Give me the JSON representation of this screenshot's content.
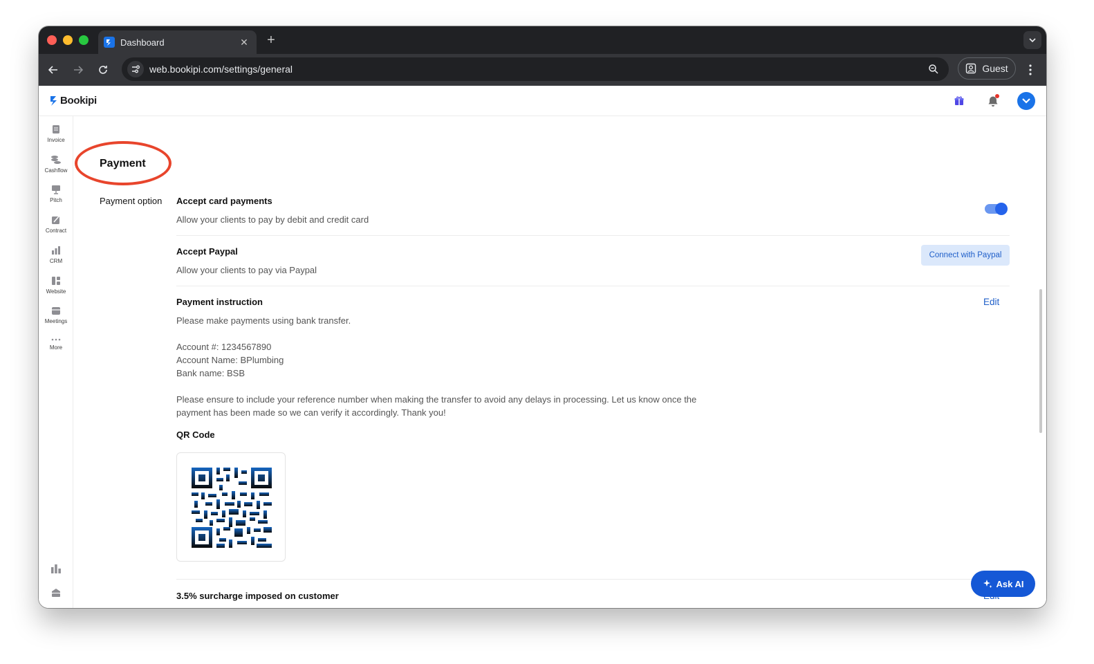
{
  "browser": {
    "tab_title": "Dashboard",
    "url": "web.bookipi.com/settings/general",
    "profile_label": "Guest"
  },
  "app": {
    "brand": "Bookipi",
    "accent_color": "#1a73e8"
  },
  "sidebar": {
    "items": [
      {
        "label": "Invoice",
        "icon": "invoice-icon"
      },
      {
        "label": "Cashflow",
        "icon": "cashflow-icon"
      },
      {
        "label": "Pitch",
        "icon": "pitch-icon"
      },
      {
        "label": "Contract",
        "icon": "contract-icon"
      },
      {
        "label": "CRM",
        "icon": "crm-icon"
      },
      {
        "label": "Website",
        "icon": "website-icon"
      },
      {
        "label": "Meetings",
        "icon": "meetings-icon"
      },
      {
        "label": "More",
        "icon": "more-icon"
      }
    ]
  },
  "payment": {
    "section_title": "Payment",
    "group_label": "Payment option",
    "card": {
      "title": "Accept card payments",
      "description": "Allow your clients to pay by debit and credit card",
      "enabled": true
    },
    "paypal": {
      "title": "Accept Paypal",
      "description": "Allow your clients to pay via Paypal",
      "button_label": "Connect with Paypal"
    },
    "instruction": {
      "title": "Payment instruction",
      "edit_label": "Edit",
      "line1": "Please make payments using bank transfer.",
      "account_number": "Account #: 1234567890",
      "account_name": "Account Name: BPlumbing",
      "bank_name": "Bank name: BSB",
      "note_line1": "Please ensure to include your reference number when making the transfer to avoid any delays in processing. Let us know once the",
      "note_line2": "payment has been made so we can verify it accordingly. Thank you!"
    },
    "qr_label": "QR Code",
    "surcharge": {
      "title": "3.5% surcharge imposed on customer",
      "edit_label": "Edit"
    }
  },
  "ask_ai_label": "Ask AI"
}
